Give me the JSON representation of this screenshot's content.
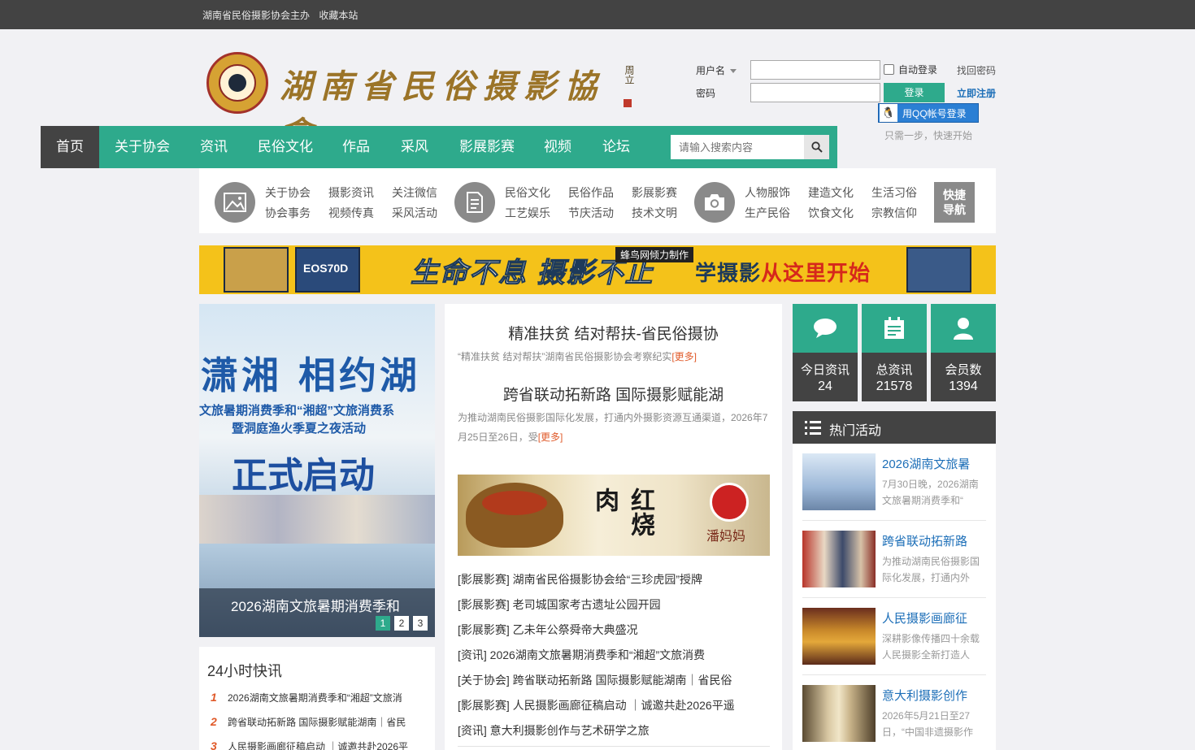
{
  "topbar": {
    "host": "湖南省民俗摄影协会主办",
    "bookmark": "收藏本站"
  },
  "logo": {
    "title": "湖南省民俗摄影協會",
    "signature": "周立"
  },
  "login": {
    "username_label": "用户名",
    "password_label": "密码",
    "auto_login": "自动登录",
    "find_password": "找回密码",
    "login_button": "登录",
    "register": "立即注册",
    "qq_login": "用QQ帐号登录",
    "hint": "只需一步，快速开始"
  },
  "nav": {
    "items": [
      "首页",
      "关于协会",
      "资讯",
      "民俗文化",
      "作品",
      "采风",
      "影展影赛",
      "视频",
      "论坛"
    ],
    "search_placeholder": "请输入搜索内容"
  },
  "quick_nav": {
    "group1": [
      "关于协会",
      "摄影资讯",
      "关注微信",
      "协会事务",
      "视频传真",
      "采风活动"
    ],
    "group2": [
      "民俗文化",
      "民俗作品",
      "影展影赛",
      "工艺娱乐",
      "节庆活动",
      "技术文明"
    ],
    "group3": [
      "人物服饰",
      "建造文化",
      "生活习俗",
      "生产民俗",
      "饮食文化",
      "宗教信仰"
    ],
    "button_line1": "快捷",
    "button_line2": "导航"
  },
  "banner": {
    "tag": "蜂鸟网倾力制作",
    "slogan": "生命不息 摄影不止",
    "slogan2_a": "学摄影",
    "slogan2_b": "从这里开始",
    "book_label": "EOS70D"
  },
  "slideshow": {
    "image_line1": "潇湘 相约湖",
    "image_line2": "文旅暑期消费季和“湘超”文旅消费系",
    "image_line3": "暨洞庭渔火季夏之夜活动",
    "image_line4": "正式启动",
    "caption": "2026湖南文旅暑期消费季和",
    "pages": [
      "1",
      "2",
      "3"
    ],
    "active_page": 1
  },
  "flash_news": {
    "title": "24小时快讯",
    "items": [
      {
        "num": "1",
        "text": "2026湖南文旅暑期消费季和“湘超”文旅消"
      },
      {
        "num": "2",
        "text": "跨省联动拓新路 国际摄影赋能湖南｜省民"
      },
      {
        "num": "3",
        "text": "人民摄影画廊征稿启动 ｜诚邀共赴2026平"
      }
    ]
  },
  "headlines": [
    {
      "title": "精准扶贫 结对帮扶-省民俗摄协",
      "summary": "“精准扶贫 结对帮扶”湖南省民俗摄影协会考察纪实",
      "more": "[更多]"
    },
    {
      "title": "跨省联动拓新路 国际摄影赋能湖",
      "summary": "为推动湖南民俗摄影国际化发展，打通内外摄影资源互通渠道，2026年7月25日至26日，受",
      "more": "[更多]"
    }
  ],
  "ad": {
    "text": "红烧肉",
    "name": "潘妈妈"
  },
  "news_list": [
    "[影展影赛]  湖南省民俗摄影协会给“三珍虎园”授牌",
    "[影展影赛]  老司城国家考古遗址公园开园",
    "[影展影赛]  乙未年公祭舜帝大典盛况",
    "[资讯]  2026湖南文旅暑期消费季和“湘超”文旅消费",
    "[关于协会]  跨省联动拓新路 国际摄影赋能湖南｜省民俗",
    "[影展影赛]  人民摄影画廊征稿启动 ｜诚邀共赴2026平遥",
    "[资讯]  意大利摄影创作与艺术研学之旅"
  ],
  "stats": [
    {
      "label": "今日资讯",
      "value": "24",
      "icon": "chat-icon"
    },
    {
      "label": "总资讯",
      "value": "21578",
      "icon": "calendar-icon"
    },
    {
      "label": "会员数",
      "value": "1394",
      "icon": "user-icon"
    }
  ],
  "hot": {
    "title": "热门活动",
    "items": [
      {
        "title": "2026湖南文旅暑",
        "desc": "7月30日晚，2026湖南文旅暑期消费季和“"
      },
      {
        "title": "跨省联动拓新路",
        "desc": "为推动湖南民俗摄影国际化发展，打通内外"
      },
      {
        "title": "人民摄影画廊征",
        "desc": "深耕影像传播四十余载人民摄影全新打造人"
      },
      {
        "title": "意大利摄影创作",
        "desc": "2026年5月21日至27日，“中国非遗摄影作"
      }
    ]
  },
  "colors": {
    "accent": "#2eaa8c",
    "dark": "#434343",
    "link": "#1d6fb8",
    "more": "#e05a2a"
  }
}
